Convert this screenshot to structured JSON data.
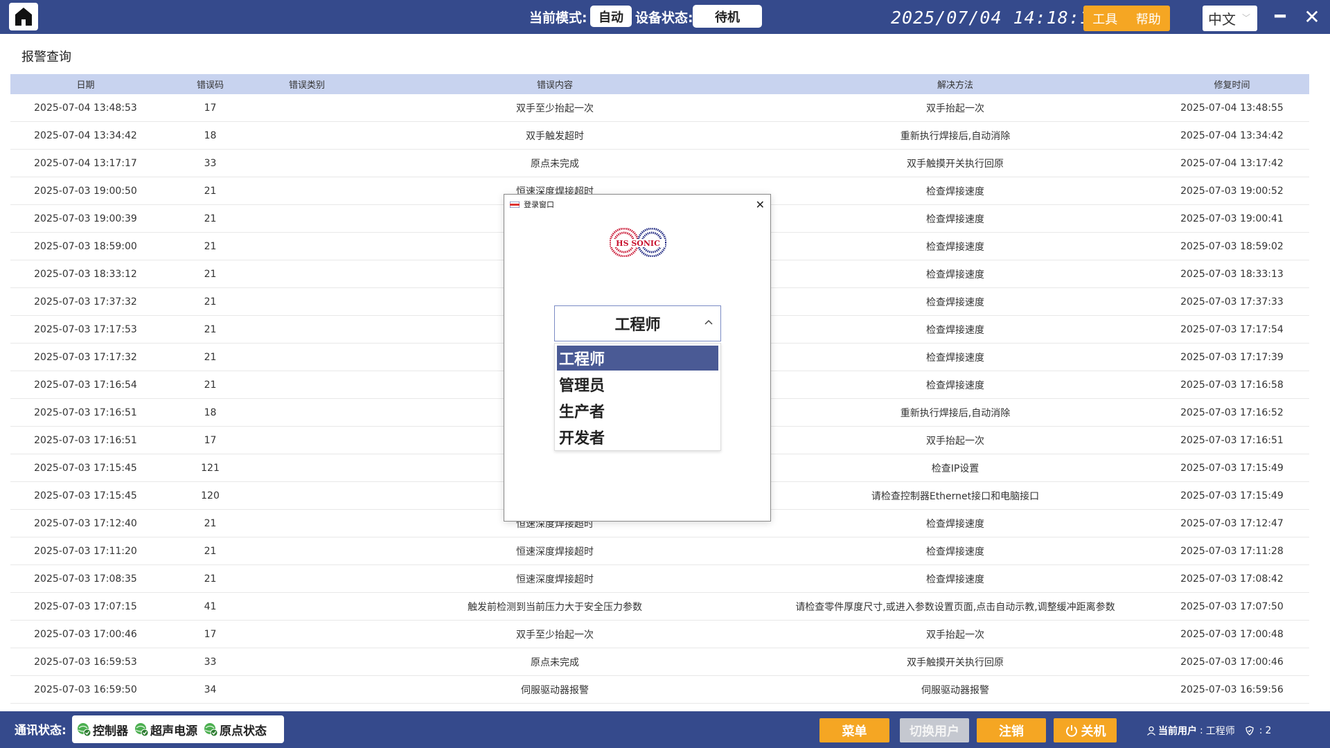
{
  "topbar": {
    "mode_label": "当前模式:",
    "mode_value": "自动",
    "state_label": "设备状态:",
    "state_value": "待机",
    "datetime": "2025/07/04  14:18:18",
    "tool_label": "工具",
    "help_label": "帮助",
    "language": "中文",
    "accent_color": "#354a8c",
    "orange_color": "#f5a623"
  },
  "page": {
    "title": "报警查询"
  },
  "table": {
    "headers": [
      "日期",
      "错误码",
      "错误类别",
      "错误内容",
      "解决方法",
      "修复时间"
    ],
    "rows": [
      [
        "2025-07-04 13:48:53",
        "17",
        "",
        "双手至少抬起一次",
        "双手抬起一次",
        "2025-07-04 13:48:55"
      ],
      [
        "2025-07-04 13:34:42",
        "18",
        "",
        "双手触发超时",
        "重新执行焊接后,自动消除",
        "2025-07-04 13:34:42"
      ],
      [
        "2025-07-04 13:17:17",
        "33",
        "",
        "原点未完成",
        "双手触摸开关执行回原",
        "2025-07-04 13:17:42"
      ],
      [
        "2025-07-03 19:00:50",
        "21",
        "",
        "恒速深度焊接超时",
        "检查焊接速度",
        "2025-07-03 19:00:52"
      ],
      [
        "2025-07-03 19:00:39",
        "21",
        "",
        "",
        "检查焊接速度",
        "2025-07-03 19:00:41"
      ],
      [
        "2025-07-03 18:59:00",
        "21",
        "",
        "",
        "检查焊接速度",
        "2025-07-03 18:59:02"
      ],
      [
        "2025-07-03 18:33:12",
        "21",
        "",
        "",
        "检查焊接速度",
        "2025-07-03 18:33:13"
      ],
      [
        "2025-07-03 17:37:32",
        "21",
        "",
        "",
        "检查焊接速度",
        "2025-07-03 17:37:33"
      ],
      [
        "2025-07-03 17:17:53",
        "21",
        "",
        "",
        "检查焊接速度",
        "2025-07-03 17:17:54"
      ],
      [
        "2025-07-03 17:17:32",
        "21",
        "",
        "",
        "检查焊接速度",
        "2025-07-03 17:17:39"
      ],
      [
        "2025-07-03 17:16:54",
        "21",
        "",
        "",
        "检查焊接速度",
        "2025-07-03 17:16:58"
      ],
      [
        "2025-07-03 17:16:51",
        "18",
        "",
        "",
        "重新执行焊接后,自动消除",
        "2025-07-03 17:16:52"
      ],
      [
        "2025-07-03 17:16:51",
        "17",
        "",
        "",
        "双手抬起一次",
        "2025-07-03 17:16:51"
      ],
      [
        "2025-07-03 17:15:45",
        "121",
        "",
        "",
        "检查IP设置",
        "2025-07-03 17:15:49"
      ],
      [
        "2025-07-03 17:15:45",
        "120",
        "",
        "",
        "请检查控制器Ethernet接口和电脑接口",
        "2025-07-03 17:15:49"
      ],
      [
        "2025-07-03 17:12:40",
        "21",
        "",
        "恒速深度焊接超时",
        "检查焊接速度",
        "2025-07-03 17:12:47"
      ],
      [
        "2025-07-03 17:11:20",
        "21",
        "",
        "恒速深度焊接超时",
        "检查焊接速度",
        "2025-07-03 17:11:28"
      ],
      [
        "2025-07-03 17:08:35",
        "21",
        "",
        "恒速深度焊接超时",
        "检查焊接速度",
        "2025-07-03 17:08:42"
      ],
      [
        "2025-07-03 17:07:15",
        "41",
        "",
        "触发前检测到当前压力大于安全压力参数",
        "请检查零件厚度尺寸,或进入参数设置页面,点击自动示教,调整缓冲距离参数",
        "2025-07-03 17:07:50"
      ],
      [
        "2025-07-03 17:00:46",
        "17",
        "",
        "双手至少抬起一次",
        "双手抬起一次",
        "2025-07-03 17:00:48"
      ],
      [
        "2025-07-03 16:59:53",
        "33",
        "",
        "原点未完成",
        "双手触摸开关执行回原",
        "2025-07-03 17:00:46"
      ],
      [
        "2025-07-03 16:59:50",
        "34",
        "",
        "伺服驱动器报警",
        "伺服驱动器报警",
        "2025-07-03 16:59:56"
      ]
    ]
  },
  "login_modal": {
    "title": "登录窗口",
    "logo_text": "HS SONIC",
    "selected_role": "工程师",
    "options": [
      "工程师",
      "管理员",
      "生产者",
      "开发者"
    ]
  },
  "bottombar": {
    "comm_label": "通讯状态:",
    "comm_items": [
      "控制器",
      "超声电源",
      "原点状态"
    ],
    "menu_label": "菜单",
    "switch_user_label": "切换用户",
    "logout_label": "注销",
    "power_label": "关机",
    "current_user_label": "当前用户",
    "current_user_value": "工程师",
    "level_value": "2"
  }
}
